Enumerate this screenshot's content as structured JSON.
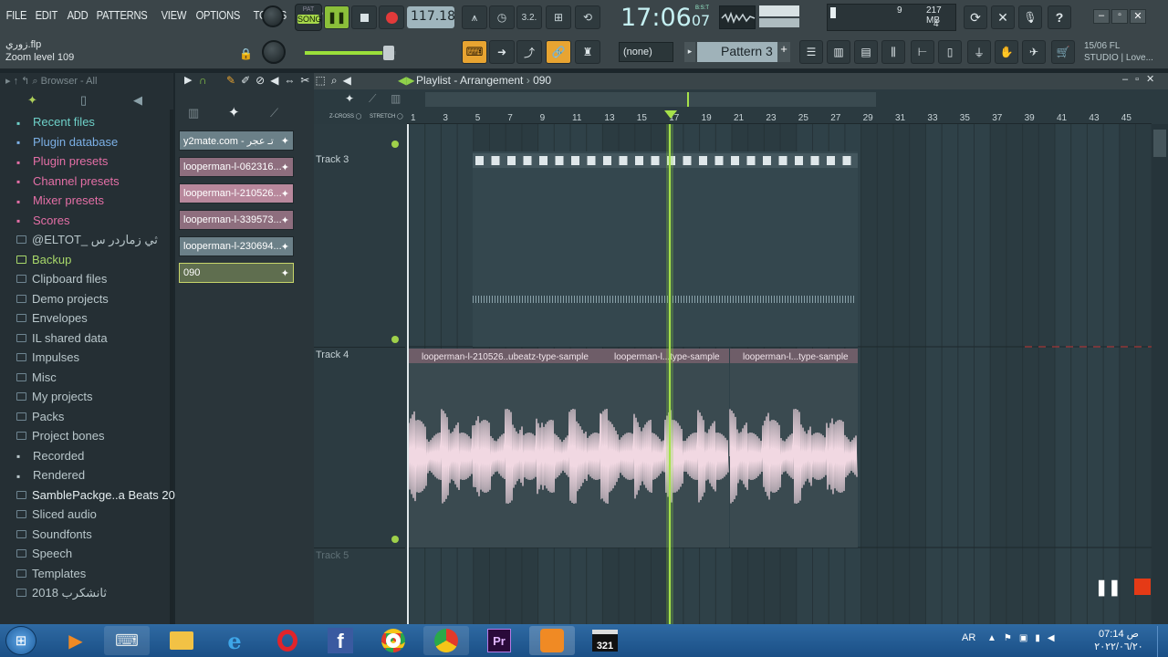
{
  "menu": [
    "FILE",
    "EDIT",
    "ADD",
    "PATTERNS",
    "VIEW",
    "OPTIONS",
    "TOOLS",
    "HELP"
  ],
  "transport": {
    "pat_label": "PAT",
    "song_label": "SONG",
    "tempo": "117.184",
    "time": "17:06",
    "time_small": "07",
    "time_unit": "B:S:T"
  },
  "cpu": {
    "ram": "217 MB",
    "poly": "4",
    "cpu": "9"
  },
  "hint": {
    "file": "زوري.flp",
    "zoom": "Zoom level 109"
  },
  "pattern": {
    "none": "(none)",
    "name": "Pattern 3"
  },
  "news": {
    "line1": "15/06  FL",
    "line2": "STUDIO | Love..."
  },
  "browser": {
    "title": "Browser - All",
    "items": [
      {
        "label": "Recent files",
        "icon": "recent-icon",
        "color": "#6ed0c8"
      },
      {
        "label": "Plugin database",
        "icon": "plugin-icon",
        "color": "#7cb0e6"
      },
      {
        "label": "Plugin presets",
        "icon": "plugin-preset-icon",
        "color": "#e46fa6"
      },
      {
        "label": "Channel presets",
        "icon": "channel-preset-icon",
        "color": "#e46fa6"
      },
      {
        "label": "Mixer presets",
        "icon": "mixer-preset-icon",
        "color": "#e46fa6"
      },
      {
        "label": "Scores",
        "icon": "note-icon",
        "color": "#e46fa6"
      },
      {
        "label": "@ELTOT_ ثي زماردر س",
        "icon": "folder-icon",
        "color": "#b9c7cb"
      },
      {
        "label": "Backup",
        "icon": "folder-icon",
        "color": "#a8d86a"
      },
      {
        "label": "Clipboard files",
        "icon": "folder-icon",
        "color": "#b9c7cb"
      },
      {
        "label": "Demo projects",
        "icon": "folder-icon",
        "color": "#b9c7cb"
      },
      {
        "label": "Envelopes",
        "icon": "folder-icon",
        "color": "#b9c7cb"
      },
      {
        "label": "IL shared data",
        "icon": "folder-icon",
        "color": "#b9c7cb"
      },
      {
        "label": "Impulses",
        "icon": "folder-icon",
        "color": "#b9c7cb"
      },
      {
        "label": "Misc",
        "icon": "folder-icon",
        "color": "#b9c7cb"
      },
      {
        "label": "My projects",
        "icon": "folder-icon",
        "color": "#b9c7cb"
      },
      {
        "label": "Packs",
        "icon": "folder-icon",
        "color": "#b9c7cb"
      },
      {
        "label": "Project bones",
        "icon": "folder-icon",
        "color": "#b9c7cb"
      },
      {
        "label": "Recorded",
        "icon": "recorded-icon",
        "color": "#b9c7cb"
      },
      {
        "label": "Rendered",
        "icon": "rendered-icon",
        "color": "#b9c7cb"
      },
      {
        "label": "SamblePackge..a Beats 2023",
        "icon": "folder-icon",
        "color": "#e6eef0"
      },
      {
        "label": "Sliced audio",
        "icon": "folder-icon",
        "color": "#b9c7cb"
      },
      {
        "label": "Soundfonts",
        "icon": "folder-icon",
        "color": "#b9c7cb"
      },
      {
        "label": "Speech",
        "icon": "folder-icon",
        "color": "#b9c7cb"
      },
      {
        "label": "Templates",
        "icon": "folder-icon",
        "color": "#b9c7cb"
      },
      {
        "label": "2018 ثانشكرب",
        "icon": "folder-icon",
        "color": "#b9c7cb"
      }
    ]
  },
  "channels": [
    {
      "label": "y2mate.com - تـ عجر",
      "color": "#6b8088"
    },
    {
      "label": "looperman-l-062316...",
      "color": "#8e6e7e"
    },
    {
      "label": "looperman-l-210526...",
      "color": "#b8889c"
    },
    {
      "label": "looperman-l-339573...",
      "color": "#8e6e7e"
    },
    {
      "label": "looperman-l-230694...",
      "color": "#6b8088"
    },
    {
      "label": "090",
      "color": "#5f6e4f"
    }
  ],
  "playlist": {
    "title": "Playlist - Arrangement",
    "sep": "›",
    "pattern": "090",
    "zcross": "Z-CROSS",
    "stretch": "STRETCH",
    "tracks": [
      "Track 3",
      "Track 4",
      "Track 5"
    ],
    "ruler": [
      "1",
      "3",
      "5",
      "7",
      "9",
      "11",
      "13",
      "15",
      "17",
      "19",
      "21",
      "23",
      "25",
      "27",
      "29",
      "31",
      "33",
      "35",
      "37",
      "39",
      "41",
      "43",
      "45"
    ],
    "clips": [
      "looperman-l-210526..ubeatz-type-sample",
      "looperman-l...type-sample",
      "looperman-l...type-sample"
    ]
  },
  "taskbar": {
    "lang": "AR",
    "time": "07:14 ص",
    "date": "٢٠٢٢/٠٦/٢٠"
  }
}
